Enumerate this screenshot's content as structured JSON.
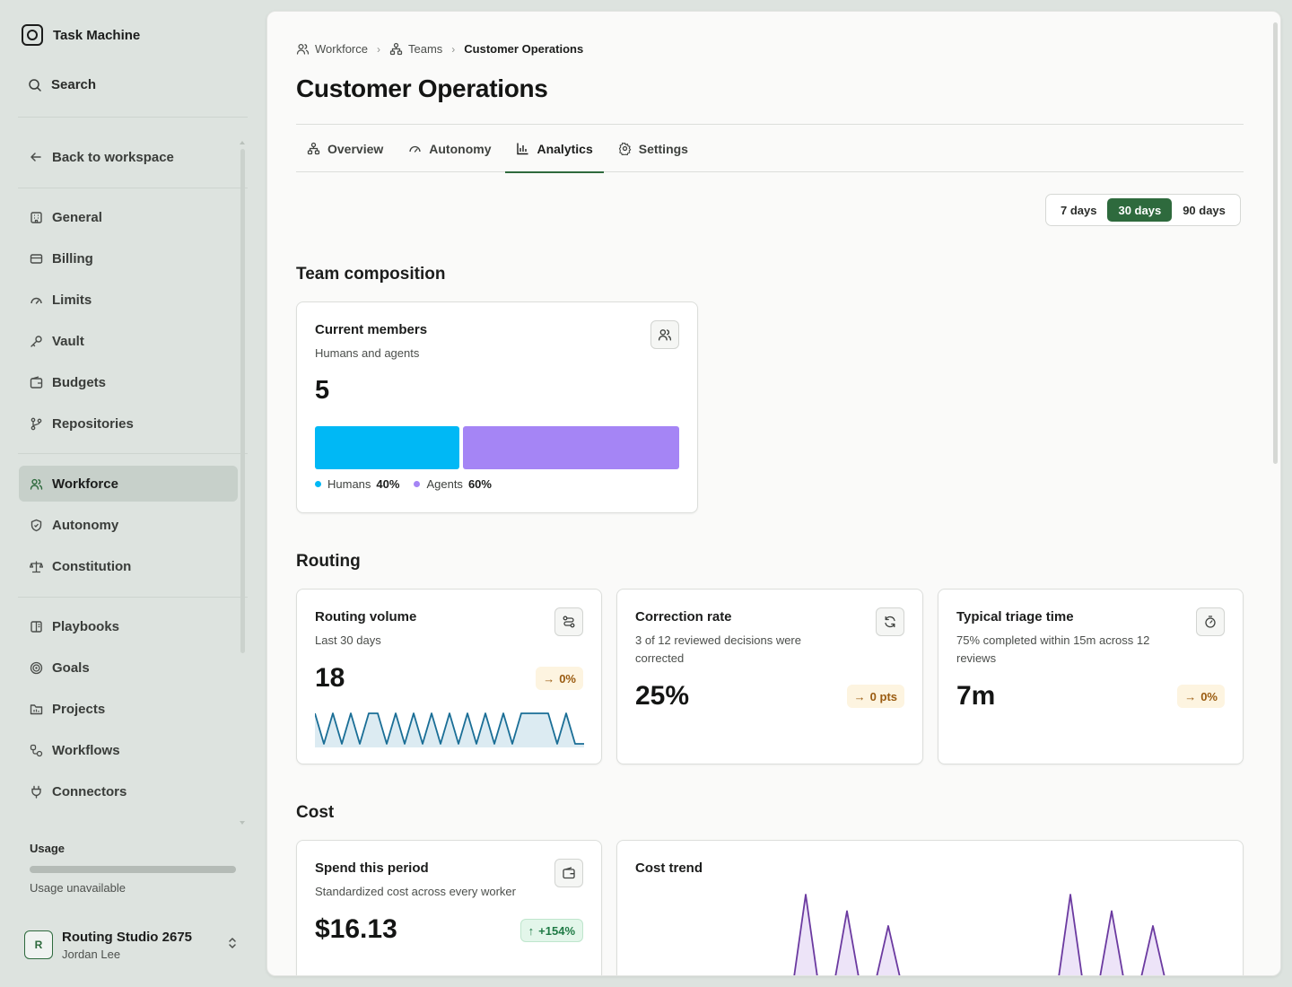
{
  "app": {
    "name": "Task Machine"
  },
  "sidebar": {
    "search_label": "Search",
    "back_label": "Back to workspace",
    "groups": [
      [
        "General",
        "Billing",
        "Limits",
        "Vault",
        "Budgets",
        "Repositories"
      ],
      [
        "Workforce",
        "Autonomy",
        "Constitution"
      ],
      [
        "Playbooks",
        "Goals",
        "Projects",
        "Workflows",
        "Connectors"
      ]
    ],
    "items": [
      {
        "label": "General",
        "icon": "building-icon"
      },
      {
        "label": "Billing",
        "icon": "credit-card-icon"
      },
      {
        "label": "Limits",
        "icon": "gauge-icon"
      },
      {
        "label": "Vault",
        "icon": "key-icon"
      },
      {
        "label": "Budgets",
        "icon": "wallet-icon"
      },
      {
        "label": "Repositories",
        "icon": "git-branch-icon"
      },
      {
        "label": "Workforce",
        "icon": "users-icon",
        "active": true
      },
      {
        "label": "Autonomy",
        "icon": "shield-icon"
      },
      {
        "label": "Constitution",
        "icon": "scale-icon"
      },
      {
        "label": "Playbooks",
        "icon": "book-icon"
      },
      {
        "label": "Goals",
        "icon": "target-icon"
      },
      {
        "label": "Projects",
        "icon": "folder-icon"
      },
      {
        "label": "Workflows",
        "icon": "workflow-icon"
      },
      {
        "label": "Connectors",
        "icon": "plug-icon"
      }
    ],
    "usage": {
      "title": "Usage",
      "status": "Usage unavailable"
    },
    "account": {
      "initial": "R",
      "name": "Routing Studio 2675",
      "user": "Jordan Lee"
    }
  },
  "breadcrumb": [
    {
      "label": "Workforce",
      "icon": "users-icon"
    },
    {
      "label": "Teams",
      "icon": "org-chart-icon"
    },
    {
      "label": "Customer Operations"
    }
  ],
  "page": {
    "title": "Customer Operations"
  },
  "tabs": [
    {
      "label": "Overview",
      "icon": "org-chart-icon"
    },
    {
      "label": "Autonomy",
      "icon": "gauge-icon"
    },
    {
      "label": "Analytics",
      "icon": "bar-chart-icon",
      "active": true
    },
    {
      "label": "Settings",
      "icon": "gear-icon"
    }
  ],
  "range": {
    "options": [
      "7 days",
      "30 days",
      "90 days"
    ],
    "selected": "30 days"
  },
  "sections": {
    "team": "Team composition",
    "routing": "Routing",
    "cost": "Cost"
  },
  "members": {
    "title": "Current members",
    "subtitle": "Humans and agents",
    "value": "5",
    "humans_label": "Humans",
    "humans_pct": "40%",
    "humans_share": 0.4,
    "agents_label": "Agents",
    "agents_pct": "60%",
    "agents_share": 0.6,
    "colors": {
      "humans": "#00b8f5",
      "agents": "#a585f5"
    }
  },
  "routing_volume": {
    "title": "Routing volume",
    "subtitle": "Last 30 days",
    "value": "18",
    "delta": "0%",
    "sparkline": [
      1,
      0,
      1,
      0,
      1,
      0,
      1,
      1,
      0,
      1,
      0,
      1,
      0,
      1,
      0,
      1,
      0,
      1,
      0,
      1,
      0,
      1,
      0,
      1,
      1,
      1,
      1,
      0,
      1,
      0,
      0
    ],
    "color": "#1a6e96"
  },
  "correction_rate": {
    "title": "Correction rate",
    "subtitle": "3 of 12 reviewed decisions were corrected",
    "value": "25%",
    "delta": "0 pts"
  },
  "triage_time": {
    "title": "Typical triage time",
    "subtitle": "75% completed within 15m across 12 reviews",
    "value": "7m",
    "delta": "0%"
  },
  "spend": {
    "title": "Spend this period",
    "subtitle": "Standardized cost across every worker",
    "value": "$16.13",
    "delta": "+154%"
  },
  "cost_trend": {
    "title": "Cost trend",
    "series": [
      0,
      0,
      0,
      0,
      0,
      0,
      0,
      0,
      0,
      0,
      0,
      0,
      0,
      0,
      0,
      0,
      0,
      0,
      0,
      0,
      0,
      1.0,
      0,
      0.8,
      0,
      0.62,
      0,
      0,
      0,
      0,
      0,
      0,
      0,
      0,
      0,
      0,
      0,
      0,
      0,
      0,
      0,
      0,
      0,
      0,
      0,
      0,
      0,
      0,
      0,
      0,
      0,
      0,
      0,
      0,
      0,
      0,
      0,
      0,
      0,
      0,
      0,
      0,
      0,
      0,
      0,
      0,
      0,
      0,
      0,
      0,
      0,
      0,
      0,
      0,
      0,
      0,
      0,
      0,
      0,
      0,
      0,
      0,
      0,
      0,
      0,
      0,
      0,
      0,
      0,
      0,
      0,
      0,
      0,
      0,
      0,
      0,
      0,
      0,
      0,
      0,
      0,
      0,
      0,
      0
    ],
    "color": "#6b3aa0"
  }
}
